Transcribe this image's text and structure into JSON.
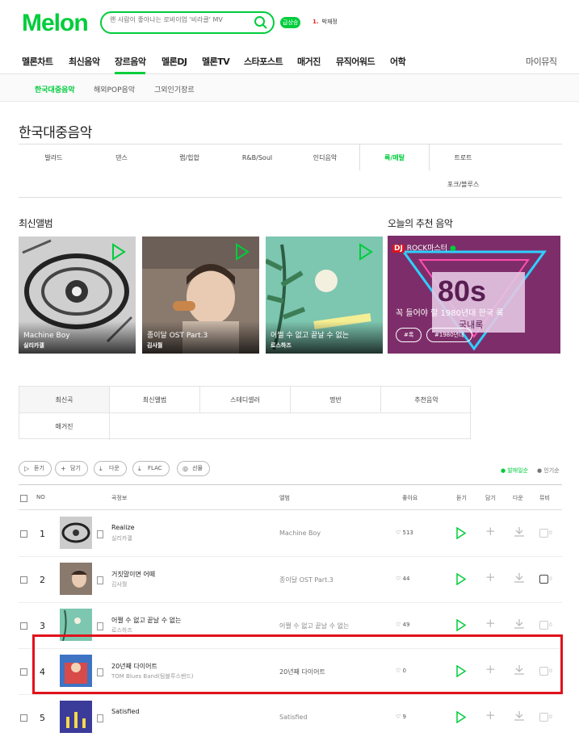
{
  "header": {
    "logo": "Melon",
    "search_placeholder": "왠 사람이 좋아나는 로바이업 '비라클' MV",
    "realtime_badge": "급상승",
    "realtime_rank": "1.",
    "realtime_keyword": "박재정"
  },
  "nav": {
    "items": [
      "멜론차트",
      "최신음악",
      "장르음악",
      "멜론DJ",
      "멜론TV",
      "스타포스트",
      "매거진",
      "뮤직어워드",
      "어학"
    ],
    "active": "장르음악",
    "mymusic": "마이뮤직"
  },
  "subnav": {
    "items": [
      "한국대중음악",
      "해외POP음악",
      "그외인기장르"
    ],
    "active": "한국대중음악"
  },
  "page_title": "한국대중음악",
  "genres": {
    "items": [
      "발라드",
      "댄스",
      "랩/힙합",
      "R&B/Soul",
      "인디음악",
      "록/메탈",
      "트로트",
      "포크/블루스"
    ],
    "active": "록/메탈"
  },
  "latest_albums": {
    "title": "최신앨범",
    "items": [
      {
        "title": "Machine Boy",
        "artist": "실리카겔"
      },
      {
        "title": "종이달 OST Part.3",
        "artist": "김사월"
      },
      {
        "title": "어쩔 수 없고 끝날 수 없는",
        "artist": "로스하즈"
      }
    ]
  },
  "recommend": {
    "title": "오늘의 추천 음악",
    "dj_label": "DJ",
    "dj_name": "ROCK마스터",
    "headline": "꼭 들어야 할 1980년대 한국 록",
    "big": "80s",
    "sub": "국내록",
    "tags": [
      "#록",
      "#1980년대"
    ],
    "colors": {
      "bg": "#7d2e6a",
      "neon": "#2fd0ff"
    }
  },
  "list_tabs": {
    "items": [
      "최신곡",
      "최신앨범",
      "스테디셀러",
      "명반",
      "추천음악",
      "매거진"
    ],
    "active": "최신곡"
  },
  "actions": {
    "listen": "듣기",
    "add": "담기",
    "download": "다운",
    "flac": "FLAC",
    "gift": "선물"
  },
  "sort": {
    "release": "발매일순",
    "popular": "인기순"
  },
  "table": {
    "headers": {
      "no": "NO",
      "song": "곡정보",
      "album": "앨범",
      "like": "좋아요",
      "listen": "듣기",
      "add": "담기",
      "download": "다운",
      "mv": "뮤비"
    },
    "rows": [
      {
        "no": "1",
        "title": "Realize",
        "artist": "실리카겔",
        "album": "Machine Boy",
        "likes": "513",
        "mv": "0"
      },
      {
        "no": "2",
        "title": "거짓말이면 어떼",
        "artist": "김사월",
        "album": "종이달 OST Part.3",
        "likes": "44",
        "mv": "0"
      },
      {
        "no": "3",
        "title": "어쩔 수 없고 끝날 수 없는",
        "artist": "로스하즈",
        "album": "어쩔 수 없고 끝날 수 없는",
        "likes": "49",
        "mv": "0"
      },
      {
        "no": "4",
        "title": "20년째 다이어트",
        "artist": "TOM Blues Band(탐블루스밴드)",
        "album": "20년째 다이어트",
        "likes": "0",
        "mv": "0"
      },
      {
        "no": "5",
        "title": "Satisfied",
        "artist": "",
        "album": "Satisfied",
        "likes": "9",
        "mv": "0"
      }
    ]
  },
  "colors": {
    "accent": "#00cd3c",
    "highlight": "#e0121b"
  }
}
